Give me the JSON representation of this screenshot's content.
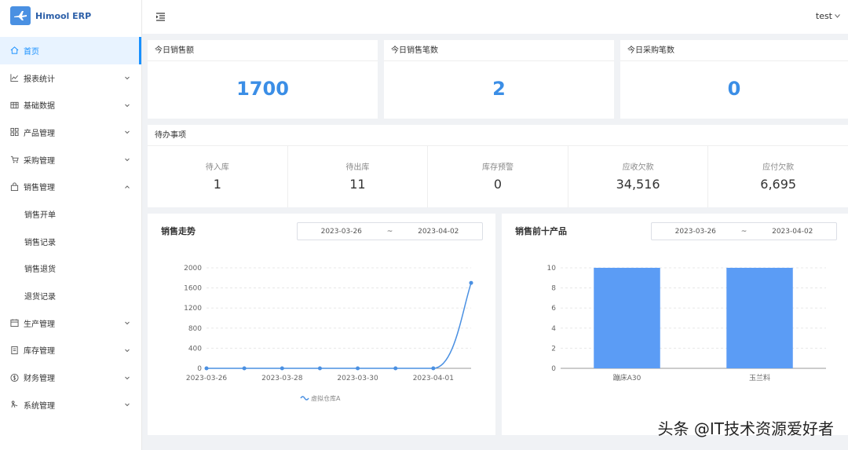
{
  "app": {
    "name": "Himool ERP",
    "user": "test"
  },
  "sidebar": {
    "items": [
      {
        "label": "首页",
        "icon": "home-icon",
        "active": true
      },
      {
        "label": "报表统计",
        "icon": "line-chart-icon",
        "expandable": true
      },
      {
        "label": "基础数据",
        "icon": "table-icon",
        "expandable": true
      },
      {
        "label": "产品管理",
        "icon": "appstore-icon",
        "expandable": true
      },
      {
        "label": "采购管理",
        "icon": "shopping-cart-icon",
        "expandable": true
      },
      {
        "label": "销售管理",
        "icon": "shopping-bag-icon",
        "expandable": true,
        "expanded": true
      },
      {
        "label": "销售开单",
        "sub": true
      },
      {
        "label": "销售记录",
        "sub": true
      },
      {
        "label": "销售退货",
        "sub": true
      },
      {
        "label": "退货记录",
        "sub": true
      },
      {
        "label": "生产管理",
        "icon": "calendar-icon",
        "expandable": true
      },
      {
        "label": "库存管理",
        "icon": "container-icon",
        "expandable": true
      },
      {
        "label": "财务管理",
        "icon": "dollar-icon",
        "expandable": true
      },
      {
        "label": "系统管理",
        "icon": "cluster-icon",
        "expandable": true
      }
    ]
  },
  "stats": [
    {
      "title": "今日销售额",
      "value": "1700"
    },
    {
      "title": "今日销售笔数",
      "value": "2"
    },
    {
      "title": "今日采购笔数",
      "value": "0"
    }
  ],
  "todo": {
    "title": "待办事项",
    "items": [
      {
        "label": "待入库",
        "value": "1"
      },
      {
        "label": "待出库",
        "value": "11"
      },
      {
        "label": "库存预警",
        "value": "0"
      },
      {
        "label": "应收欠款",
        "value": "34,516"
      },
      {
        "label": "应付欠款",
        "value": "6,695"
      }
    ]
  },
  "sales_trend": {
    "title": "销售走势",
    "date_start": "2023-03-26",
    "date_sep": "~",
    "date_end": "2023-04-02"
  },
  "top_products": {
    "title": "销售前十产品",
    "date_start": "2023-03-26",
    "date_sep": "~",
    "date_end": "2023-04-02"
  },
  "colors": {
    "accent": "#3b8ee6",
    "line": "#4a90e2",
    "bar": "#5b9cf5"
  },
  "watermark": "头条 @IT技术资源爱好者",
  "chart_data": [
    {
      "type": "line",
      "x": [
        "2023-03-26",
        "2023-03-27",
        "2023-03-28",
        "2023-03-29",
        "2023-03-30",
        "2023-03-31",
        "2023-04-01",
        "2023-04-02"
      ],
      "x_tick_labels": [
        "2023-03-26",
        "2023-03-28",
        "2023-03-30",
        "2023-04-01"
      ],
      "series": [
        {
          "name": "虚拟仓库A",
          "values": [
            0,
            0,
            0,
            0,
            0,
            0,
            0,
            1700
          ]
        }
      ],
      "ylim": [
        0,
        2000
      ],
      "yticks": [
        0,
        400,
        800,
        1200,
        1600,
        2000
      ],
      "grid": true,
      "legend": "bottom"
    },
    {
      "type": "bar",
      "categories": [
        "蹦床A30",
        "玉兰料"
      ],
      "values": [
        10,
        10
      ],
      "ylim": [
        0,
        10
      ],
      "yticks": [
        0,
        2,
        4,
        6,
        8,
        10
      ],
      "grid": true
    }
  ]
}
